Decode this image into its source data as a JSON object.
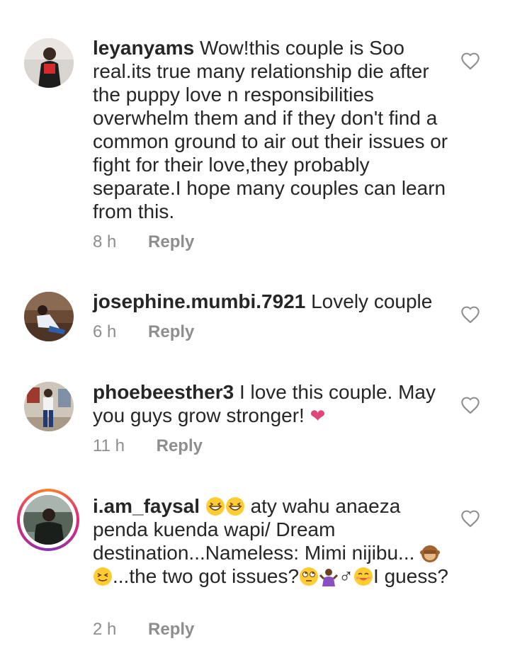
{
  "comments": [
    {
      "username": "leyanyams",
      "text": "Wow!this couple is Soo real.its true many relationship die after the puppy love n responsibilities overwhelm them and if they don't find a common ground to air out their issues or fight for their love,they probably separate.I hope many couples can learn from this.",
      "time": "8 h",
      "reply": "Reply"
    },
    {
      "username": "josephine.mumbi.7921",
      "text": "Lovely  couple",
      "time": "6 h",
      "reply": "Reply"
    },
    {
      "username": "phoebeesther3",
      "text": "I love this couple. May you guys grow stronger!",
      "emoji_end": "❤",
      "time": "11 h",
      "reply": "Reply"
    },
    {
      "username": "i.am_faysal",
      "text_a": "aty wahu anaeza penda kuenda wapi/ Dream destination...Nameless: Mimi nijibu...",
      "text_b": "...the two got issues?",
      "text_c": "I guess?",
      "male_sign": "♂",
      "time": "2 h",
      "reply": "Reply"
    }
  ],
  "colors": {
    "text": "#262626",
    "meta": "#8e8e8e",
    "heart_outline": "#8e8e8e",
    "pink_heart": "#e2457a"
  }
}
